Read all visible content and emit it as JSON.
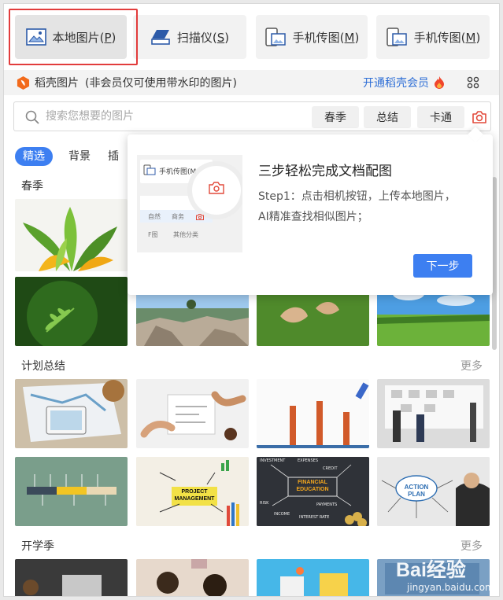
{
  "source_buttons": [
    {
      "label": "本地图片(",
      "key": "P",
      "suffix": ")",
      "icon": "local-image-icon"
    },
    {
      "label": "扫描仪(",
      "key": "S",
      "suffix": ")",
      "icon": "scanner-icon"
    },
    {
      "label": "手机传图(",
      "key": "M",
      "suffix": ")",
      "icon": "phone-image-icon"
    },
    {
      "label": "手机传图(",
      "key": "M",
      "suffix": ")",
      "icon": "phone-image-icon"
    }
  ],
  "brand": {
    "name": "稻壳图片",
    "note": "(非会员仅可使用带水印的图片)",
    "vip_link": "开通稻壳会员",
    "brand_color": "#f26a1b"
  },
  "search": {
    "placeholder": "搜索您想要的图片",
    "chips": [
      "春季",
      "总结",
      "卡通"
    ]
  },
  "tabs": [
    "精选",
    "背景",
    "插"
  ],
  "sections": [
    {
      "title": "春季",
      "more": ""
    },
    {
      "title": "计划总结",
      "more": "更多"
    },
    {
      "title": "开学季",
      "more": "更多"
    }
  ],
  "popover": {
    "title": "三步轻松完成文档配图",
    "step_line1": "Step1：点击相机按钮，上传本地图片，",
    "step_line2": "AI精准查找相似图片；",
    "next_label": "下一步",
    "illus_phone": "手机传图(M",
    "illus_tag1": "自然",
    "illus_tag2": "商务",
    "illus_tag3": "F图",
    "illus_tag4": "其他分类"
  },
  "thumb_texts": {
    "project_management": "PROJECT MANAGEMENT",
    "financial_education": "FINANCIAL EDUCATION",
    "action_plan": "ACTION PLAN",
    "fin_words": [
      "INVESTMENT",
      "EXPENSES",
      "CREDIT",
      "RISK",
      "INCOME",
      "PAYMENTS",
      "INTEREST RATE"
    ]
  },
  "watermark": {
    "text": "Bai经验",
    "url": "jingyan.baidu.com"
  },
  "colors": {
    "accent": "#3d7ff1",
    "highlight": "#e23c3c",
    "link": "#2f6fd6"
  }
}
